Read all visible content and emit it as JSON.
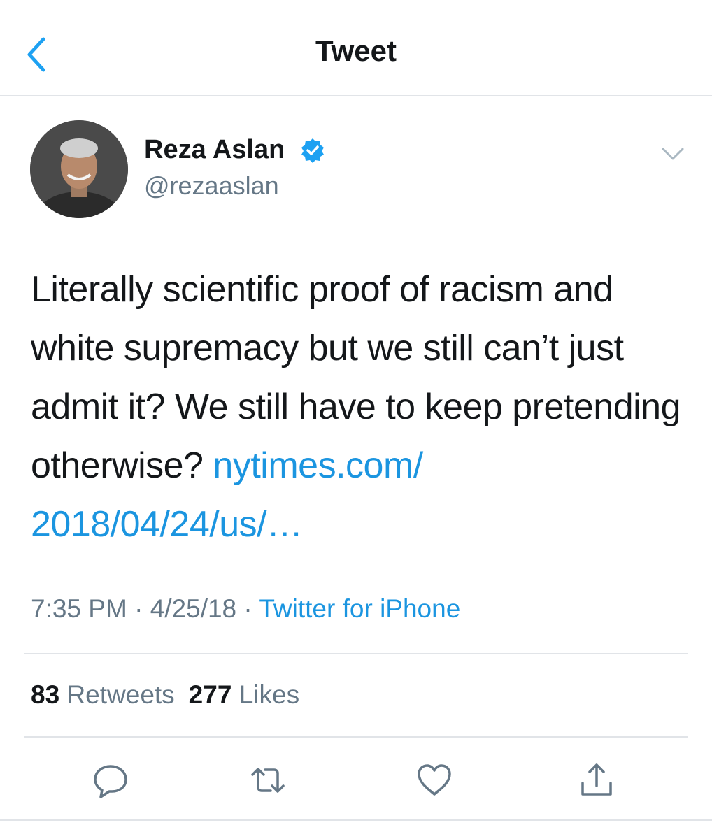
{
  "header": {
    "title": "Tweet",
    "back_icon": "chevron-left-icon"
  },
  "author": {
    "name": "Reza Aslan",
    "handle": "@rezaaslan",
    "verified": true
  },
  "tweet": {
    "text": "Literally scientific proof of racism and white supremacy but we still can’t just admit it? We still have to keep pretending otherwise?",
    "link": "nytimes.com/ 2018/04/24/us/…"
  },
  "meta": {
    "time": "7:35 PM",
    "date": "4/25/18",
    "separator": "·",
    "source": "Twitter for iPhone"
  },
  "stats": {
    "retweets_count": "83",
    "retweets_label": "Retweets",
    "likes_count": "277",
    "likes_label": "Likes"
  },
  "actions": [
    "reply-icon",
    "retweet-icon",
    "like-icon",
    "share-icon"
  ],
  "colors": {
    "link": "#1b95e0",
    "secondary_text": "#657786",
    "primary_text": "#14171a",
    "divider": "#e1e4e8"
  }
}
